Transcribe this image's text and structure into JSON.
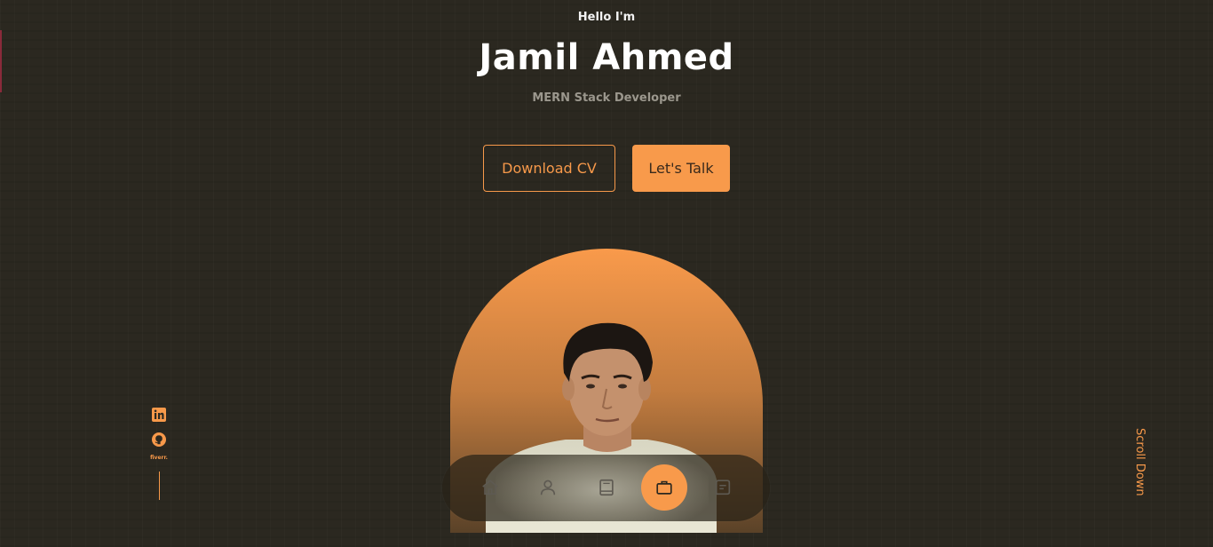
{
  "hero": {
    "greeting": "Hello I'm",
    "name": "Jamil Ahmed",
    "role": "MERN Stack Developer"
  },
  "buttons": {
    "download_cv": "Download CV",
    "lets_talk": "Let's Talk"
  },
  "socials": {
    "items": [
      "linkedin-icon",
      "github-icon",
      "fiverr"
    ],
    "fiverr_label": "fiverr."
  },
  "scroll": {
    "label": "Scroll Down"
  },
  "nav": {
    "items": [
      "home-icon",
      "user-icon",
      "book-icon",
      "briefcase-icon",
      "message-icon"
    ],
    "active": "briefcase-icon"
  },
  "colors": {
    "accent": "#f89a4b",
    "background": "#2b2820",
    "text_primary": "#ffffff",
    "text_muted": "#9b978d"
  }
}
